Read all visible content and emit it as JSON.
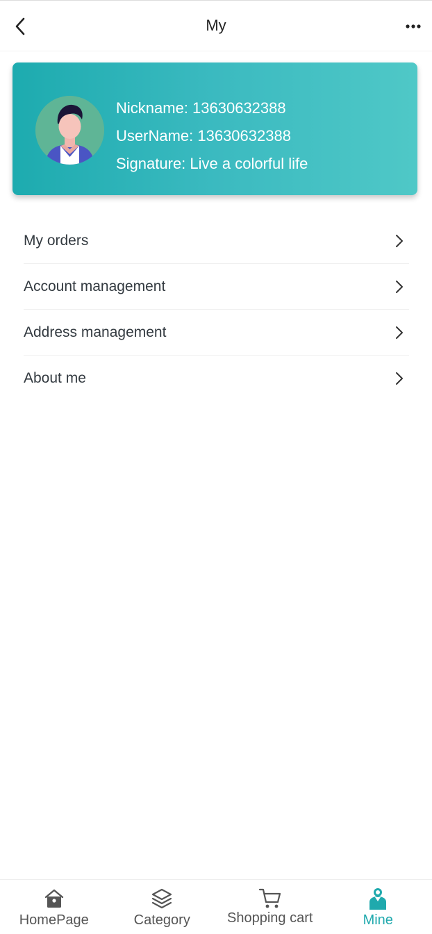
{
  "header": {
    "title": "My"
  },
  "profile": {
    "nickname": "Nickname: 13630632388",
    "username": "UserName: 13630632388",
    "signature": "Signature: Live a colorful life"
  },
  "menu": {
    "items": [
      {
        "label": "My orders"
      },
      {
        "label": "Account management"
      },
      {
        "label": "Address management"
      },
      {
        "label": "About me"
      }
    ]
  },
  "tabbar": {
    "tabs": [
      {
        "label": "HomePage",
        "icon": "home-icon"
      },
      {
        "label": "Category",
        "icon": "layers-icon"
      },
      {
        "label": "Shopping cart",
        "icon": "cart-icon"
      },
      {
        "label": "Mine",
        "icon": "user-icon",
        "active": true
      }
    ]
  },
  "colors": {
    "accent": "#1fa9ad",
    "card_gradient_start": "#1dabaf",
    "card_gradient_end": "#4fc8c7"
  }
}
